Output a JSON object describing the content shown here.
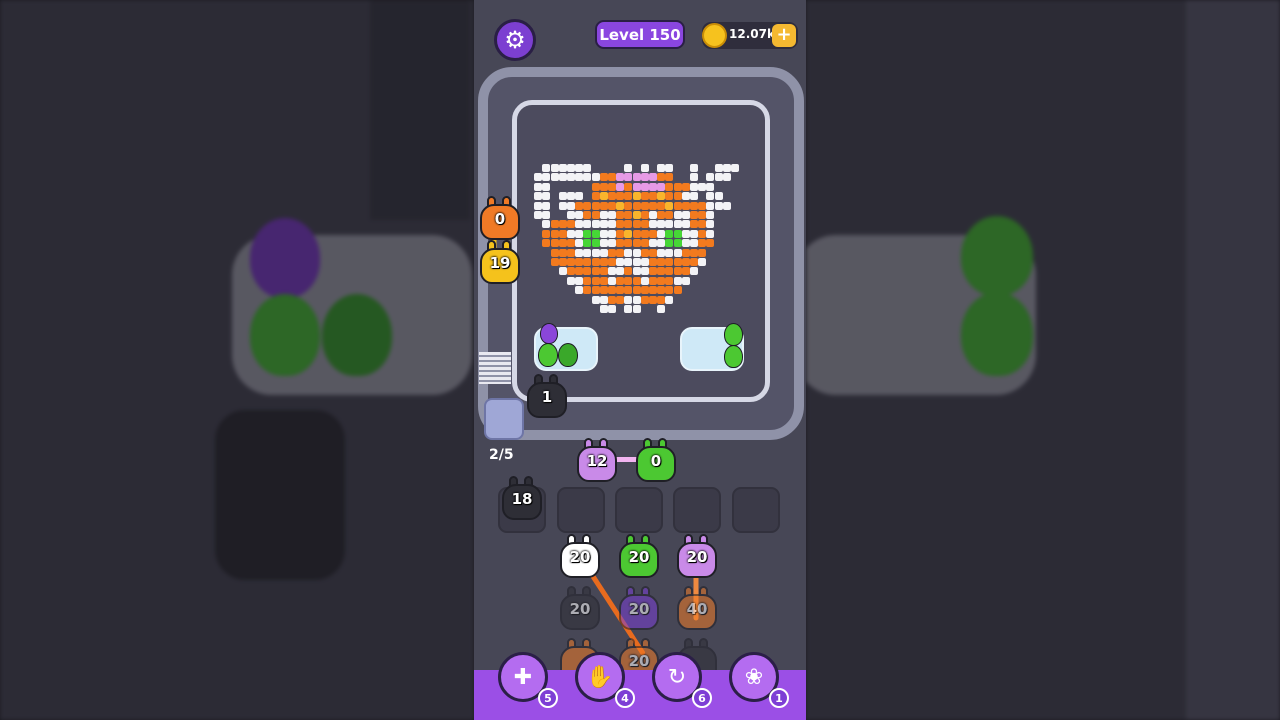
{
  "hud": {
    "level_label": "Level 150",
    "coins": "12.07k",
    "coin_add": "+"
  },
  "icons": {
    "settings": "gear-icon",
    "coin": "coin-icon"
  },
  "pickers": [
    {
      "color": "#f07a26",
      "count": "0"
    },
    {
      "color": "#f5c21c",
      "count": "19"
    }
  ],
  "conveyor_bunny": {
    "color": "#2e2e36",
    "count": "1"
  },
  "queue_counter": "2/5",
  "holding": [
    {
      "color": "#c98ae8",
      "count": "12"
    },
    {
      "color": "#4cc832",
      "count": "0"
    }
  ],
  "slots": [
    {
      "color": "#2e2e36",
      "count": "18"
    }
  ],
  "columns": [
    {
      "bunnies": [
        {
          "color": "#ffffff",
          "count": "20"
        },
        {
          "color": "#2e2e36",
          "count": "20"
        },
        {
          "color": "#f07a26",
          "count": ""
        }
      ]
    },
    {
      "bunnies": [
        {
          "color": "#4cc832",
          "count": "20"
        },
        {
          "color": "#7b3fd6",
          "count": "20"
        },
        {
          "color": "#f07a26",
          "count": "20"
        }
      ]
    },
    {
      "bunnies": [
        {
          "color": "#c98ae8",
          "count": "20"
        },
        {
          "color": "#f07a26",
          "count": "40"
        },
        {
          "color": "#2e2e36",
          "count": ""
        }
      ]
    }
  ],
  "powerups": [
    {
      "name": "add-slot",
      "icon": "add-box-icon",
      "glyph": "✚",
      "count": "5"
    },
    {
      "name": "hand",
      "icon": "hand-icon",
      "glyph": "✋",
      "count": "4"
    },
    {
      "name": "shuffle",
      "icon": "shuffle-icon",
      "glyph": "↻",
      "count": "6"
    },
    {
      "name": "magic-bunny",
      "icon": "bunny-icon",
      "glyph": "❀",
      "count": "1"
    }
  ],
  "egg_trays": [
    {
      "eggs": [
        {
          "color": "#8a46d9"
        },
        {
          "color": "#4cc832"
        },
        {
          "color": "#3aa82a"
        }
      ]
    },
    {
      "eggs": [
        {
          "color": "#4cc832"
        },
        {
          "color": "#4cc832"
        }
      ]
    }
  ],
  "palette": {
    "W": "#f3f3f6",
    "O": "#f27a1e",
    "Y": "#f9b52c",
    "P": "#e79ae6",
    "G": "#46d636",
    "K": "#2b2b33"
  },
  "pixel_art": [
    "..WWWWWW....W.W.WW..W..WWW.",
    ".WWWWWWWWOOPPPPPOO..W.WWW..",
    ".WW.....OOOPOPPPPOOOWWW....",
    ".WW.WWW.OYOOOYOOYOOWW.WW...",
    ".WW.WWOOOOOYOOOOOYOOOOWWW..",
    ".WW..WWOOWWOOYOWOOWWOOW....",
    "..WOOOWWWWWOOOOWWWWWOOW....",
    "..OOOWWGGWWOYOOOWGGWWOW....",
    "..OOOOWGGWWOOOOWWGGWWOO....",
    "...OOOWWWWOOWWOOWWWOOO.....",
    "...OOOOOOOOWWWWOOOOOOW.....",
    "....WOOOOOWWOWWOOOOOW......",
    ".....WWOOOWOOOWOOOWW.......",
    "......WOOOOOOOOOOOO........",
    "........WWOOWWOOOW.........",
    ".........WW.WW..W.........."
  ]
}
